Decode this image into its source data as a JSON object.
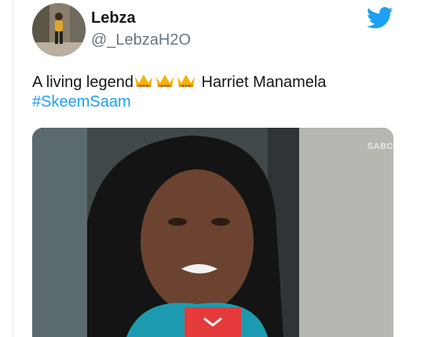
{
  "tweet": {
    "display_name": "Lebza",
    "handle": "@_LebzaH2O",
    "text_before": "A living legend",
    "emoji_icons": [
      "crown-icon",
      "crown-icon",
      "crown-icon"
    ],
    "text_after": " Harriet Manamela",
    "hashtag": "#SkeemSaam"
  },
  "media": {
    "watermark": "SABC"
  },
  "brand": {
    "logo_icon": "twitter-bird-icon",
    "link_color": "#1da1f2",
    "expand_button_color": "#e53a3a",
    "expand_icon": "chevron-down-icon"
  }
}
